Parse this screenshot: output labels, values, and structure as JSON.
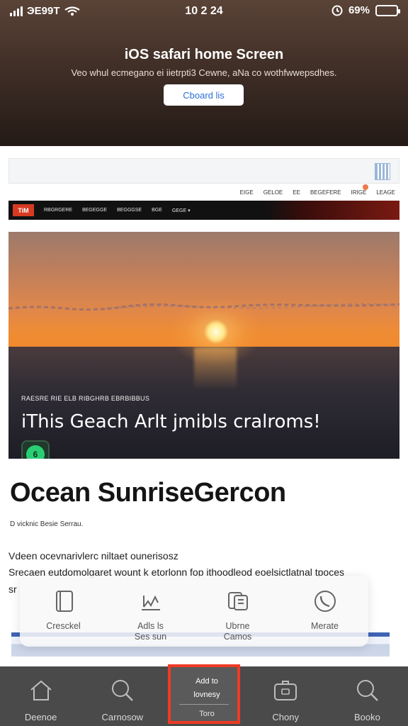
{
  "status_bar": {
    "carrier": "ЭE99T",
    "time": "10 2 24",
    "battery": "69%"
  },
  "banner": {
    "title": "iOS safari home Screen",
    "subtitle": "Veo whul ecmegano ei iietrpti3 Cewne, aNa co wothfwwepsdhes.",
    "button_label": "Cboard lis"
  },
  "site": {
    "utility_links": [
      "EIGE",
      "GELOE",
      "EE",
      "BEGEFERE",
      "IRIGE",
      "LEAGE"
    ],
    "nav_logo": "TiM",
    "nav_items": [
      "RBGRGERE",
      "BEGEGGE",
      "BEGGGSE",
      "BGE",
      "GEGE ▾"
    ]
  },
  "hero": {
    "kicker": "RAESRE RIE ELB RIBGHRB EBRBIBBUS",
    "caption": "iThis Geach Arlt jmibls cralroms!",
    "badge_glyph": "6"
  },
  "article": {
    "headline": "Ocean SunriseGercon",
    "byline": "D vicknic Besie Serrau.",
    "paragraph_lines": [
      "Vdeen ocevnarivlerc niltaet ounerisosz",
      "Srecaen eutdomolgaret wount k etorlonn fop ithoodleod eoelsictlatnal tpoces",
      "sr"
    ]
  },
  "share_sheet": {
    "actions": [
      {
        "label": "Cresckel",
        "icon": "notebook-icon"
      },
      {
        "label": "Adls ls\nSes sun",
        "icon": "chart-icon"
      },
      {
        "label": "Ubrne\nCamos",
        "icon": "copy-icon"
      },
      {
        "label": "Merate",
        "icon": "phone-icon"
      }
    ]
  },
  "toolbar": {
    "items": [
      {
        "label": "Deenoe",
        "icon": "home-icon"
      },
      {
        "label": "Carnosow",
        "icon": "search-icon"
      },
      {
        "label": "",
        "icon": ""
      },
      {
        "label": "Chony",
        "icon": "tabs-icon"
      },
      {
        "label": "Booko",
        "icon": "search-icon"
      }
    ],
    "highlighted": {
      "line1": "Add to",
      "line2": "lovnesy",
      "line3": "Toro"
    }
  },
  "colors": {
    "highlight": "#ef3a24",
    "accent_link": "#2d6fd6",
    "toolbar_bg": "#4a4a4a"
  }
}
